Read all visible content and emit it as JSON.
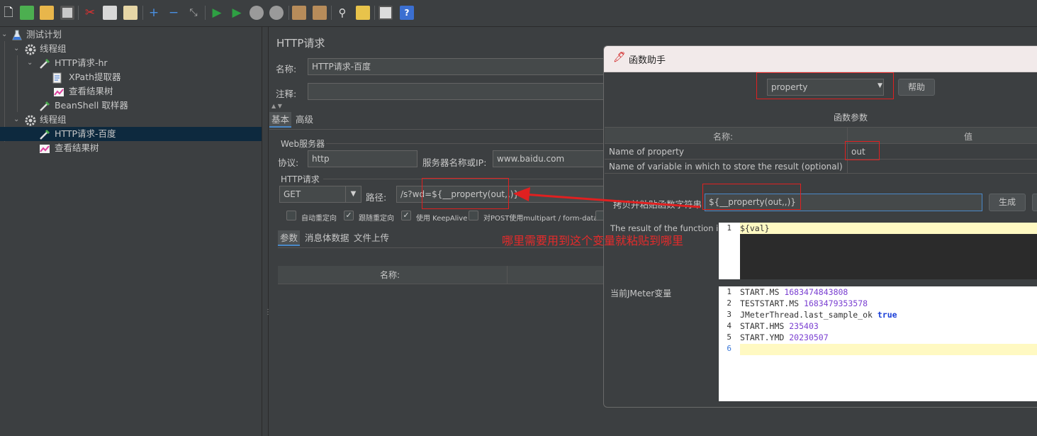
{
  "toolbar": {
    "icons": [
      "new-icon",
      "templates-icon",
      "open-icon",
      "save-icon",
      "cut-icon",
      "copy-icon",
      "paste-icon",
      "expand-icon",
      "collapse-icon",
      "toggle-icon",
      "start-icon",
      "start-no-pause-icon",
      "stop-icon",
      "shutdown-icon",
      "clear-icon",
      "clear-all-icon",
      "search-icon",
      "reset-search-icon",
      "function-helper-icon",
      "help-icon"
    ]
  },
  "tree": {
    "items": [
      {
        "label": "测试计划",
        "icon": "flask-icon"
      },
      {
        "label": "线程组",
        "icon": "gear-icon"
      },
      {
        "label": "HTTP请求-hr",
        "icon": "pipette-icon"
      },
      {
        "label": "XPath提取器",
        "icon": "document-icon"
      },
      {
        "label": "查看结果树",
        "icon": "graph-icon"
      },
      {
        "label": "BeanShell 取样器",
        "icon": "pipette-icon"
      },
      {
        "label": "线程组",
        "icon": "gear-icon"
      },
      {
        "label": "HTTP请求-百度",
        "icon": "pipette-icon"
      },
      {
        "label": "查看结果树",
        "icon": "graph-icon"
      }
    ]
  },
  "main": {
    "title": "HTTP请求",
    "name_label": "名称:",
    "name_value": "HTTP请求-百度",
    "comment_label": "注释:",
    "comment_value": "",
    "tabs": [
      {
        "label": "基本"
      },
      {
        "label": "高级"
      }
    ],
    "web_server_group": "Web服务器",
    "protocol_label": "协议:",
    "protocol_value": "http",
    "server_label": "服务器名称或IP:",
    "server_value": "www.baidu.com",
    "http_request_group": "HTTP请求",
    "method_value": "GET",
    "path_label": "路径:",
    "path_value": "/s?wd=${__property(out,,)}",
    "checkboxes": [
      {
        "label": "自动重定向",
        "checked": false
      },
      {
        "label": "跟随重定向",
        "checked": true
      },
      {
        "label": "使用 KeepAlive",
        "checked": true
      },
      {
        "label": "对POST使用multipart / form-data",
        "checked": false
      }
    ],
    "subtabs": [
      {
        "label": "参数"
      },
      {
        "label": "消息体数据"
      },
      {
        "label": "文件上传"
      }
    ],
    "table_col_name": "名称:"
  },
  "annotation": {
    "text": "哪里需要用到这个变量就粘贴到哪里",
    "color": "#e52b2b"
  },
  "dialog": {
    "title": "函数助手",
    "function_selected": "property",
    "help_button": "帮助",
    "params_title": "函数参数",
    "col_name": "名称:",
    "col_value": "值",
    "params": [
      {
        "name": "Name of property",
        "value": "out"
      },
      {
        "name": "Name of variable in which to store the result (optional)",
        "value": ""
      }
    ],
    "copy_label": "拷贝并粘贴函数字符串",
    "function_string": "${__property(out,,)}",
    "generate_button": "生成",
    "result_label": "The result of the function is",
    "result_lines": [
      {
        "num": "1",
        "text": "${val}"
      }
    ],
    "vars_label": "当前JMeter变量",
    "vars_lines": [
      {
        "num": "1",
        "key": "START.MS",
        "value": "1683474843808"
      },
      {
        "num": "2",
        "key": "TESTSTART.MS",
        "value": "1683479353578"
      },
      {
        "num": "3",
        "key": "JMeterThread.last_sample_ok",
        "value": "true"
      },
      {
        "num": "4",
        "key": "START.HMS",
        "value": "235403"
      },
      {
        "num": "5",
        "key": "START.YMD",
        "value": "20230507"
      },
      {
        "num": "6",
        "key": "",
        "value": ""
      }
    ]
  }
}
